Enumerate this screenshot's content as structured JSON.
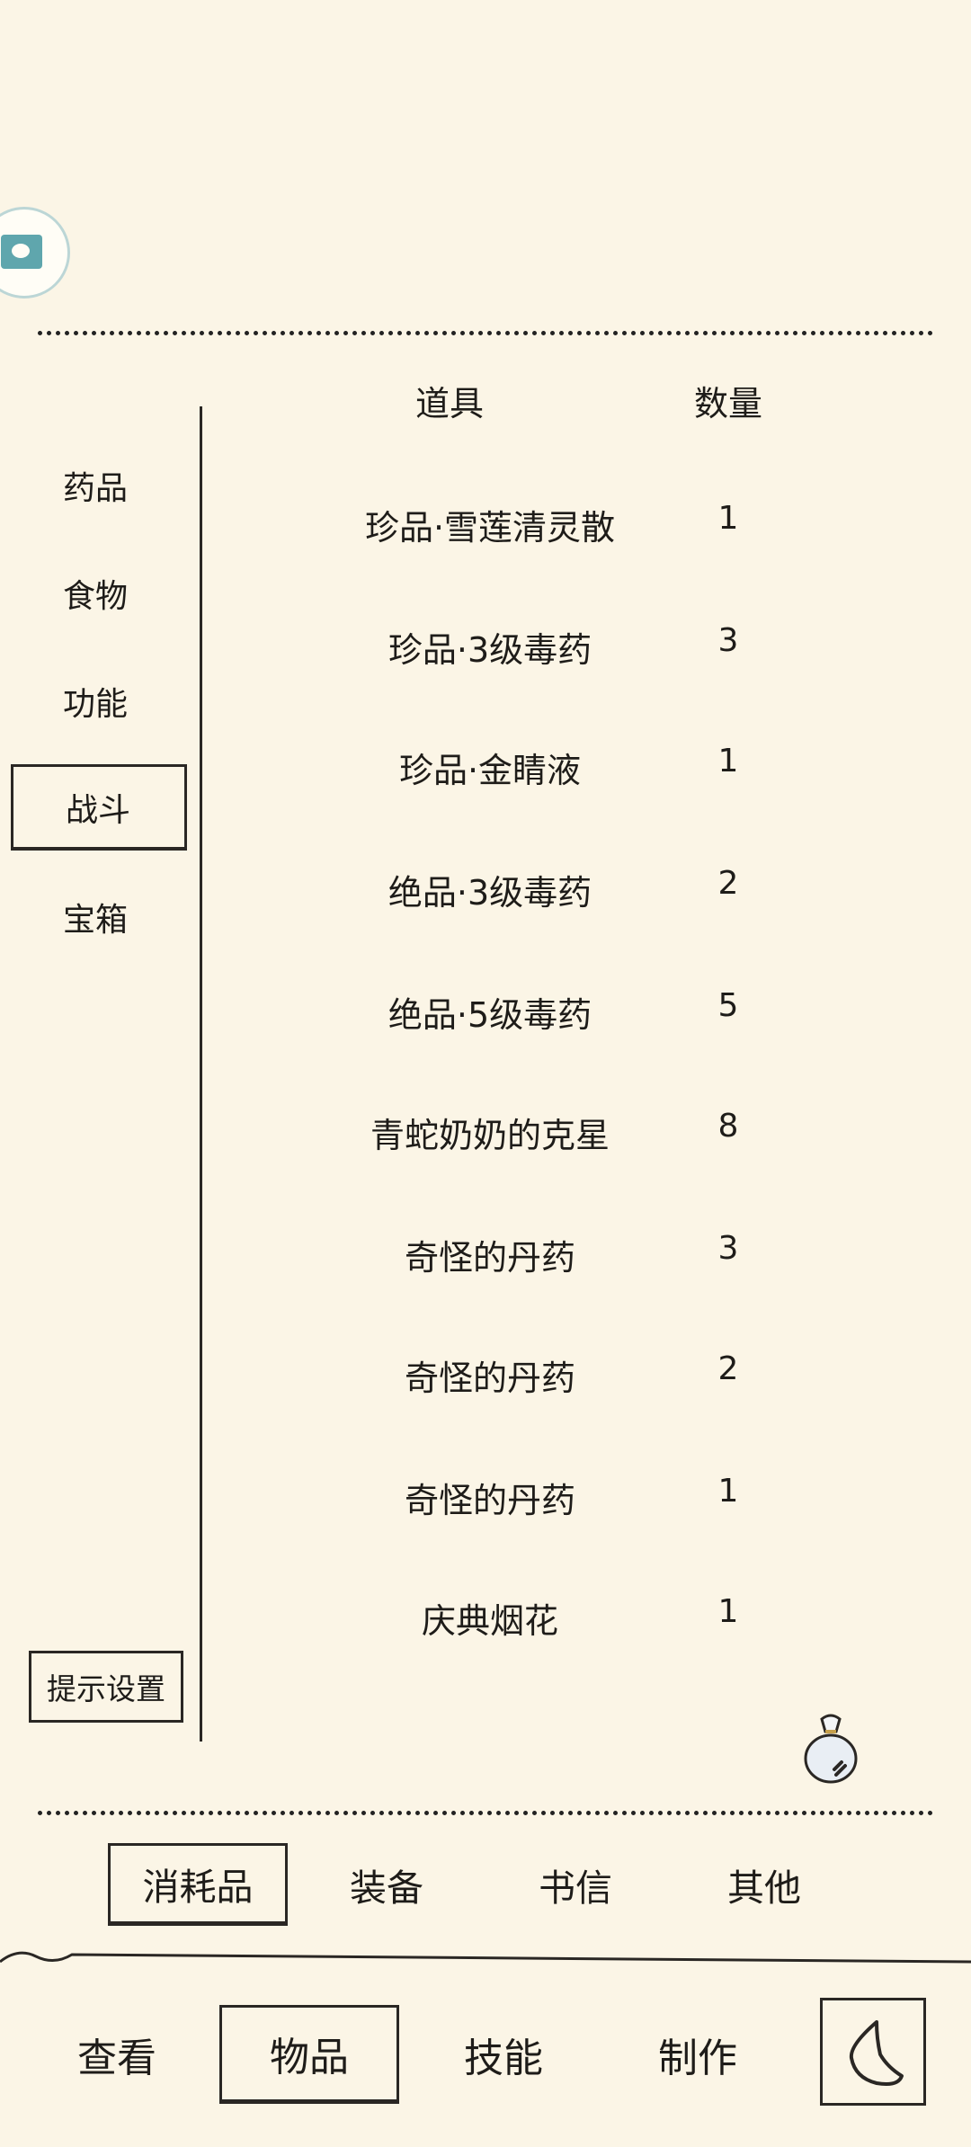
{
  "sidebar": {
    "items": [
      {
        "label": "药品"
      },
      {
        "label": "食物"
      },
      {
        "label": "功能"
      },
      {
        "label": "战斗"
      },
      {
        "label": "宝箱"
      }
    ],
    "selected": "战斗",
    "hint_button": "提示设置"
  },
  "table": {
    "headers": {
      "item": "道具",
      "qty": "数量"
    },
    "rows": [
      {
        "name": "珍品·雪莲清灵散",
        "qty": "1"
      },
      {
        "name": "珍品·3级毒药",
        "qty": "3"
      },
      {
        "name": "珍品·金睛液",
        "qty": "1"
      },
      {
        "name": "绝品·3级毒药",
        "qty": "2"
      },
      {
        "name": "绝品·5级毒药",
        "qty": "5"
      },
      {
        "name": "青蛇奶奶的克星",
        "qty": "8"
      },
      {
        "name": "奇怪的丹药",
        "qty": "3"
      },
      {
        "name": "奇怪的丹药",
        "qty": "2"
      },
      {
        "name": "奇怪的丹药",
        "qty": "1"
      },
      {
        "name": "庆典烟花",
        "qty": "1"
      }
    ]
  },
  "category_tabs": [
    {
      "label": "消耗品"
    },
    {
      "label": "装备"
    },
    {
      "label": "书信"
    },
    {
      "label": "其他"
    }
  ],
  "selected_category": "消耗品",
  "bottom_nav": [
    {
      "label": "查看"
    },
    {
      "label": "物品"
    },
    {
      "label": "技能"
    },
    {
      "label": "制作"
    }
  ],
  "selected_nav": "物品",
  "icons": {
    "top_left": "home-badge-icon",
    "bag": "bag-icon",
    "back": "back-icon"
  },
  "colors": {
    "background": "#fbf5e6",
    "ink": "#2a2724",
    "badge_accent": "#5fa6ad"
  }
}
